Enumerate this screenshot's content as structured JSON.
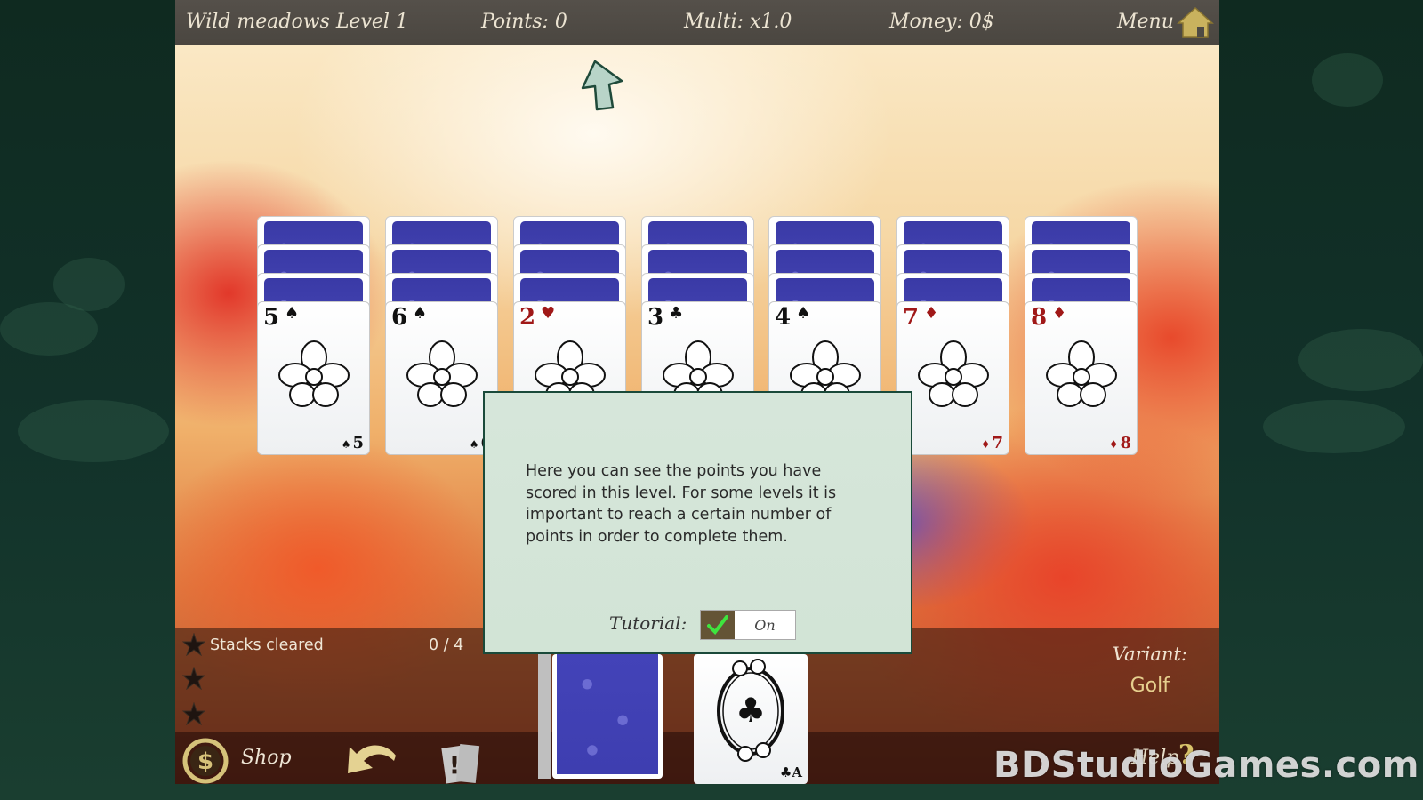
{
  "topbar": {
    "level_title": "Wild meadows Level 1",
    "points": "Points: 0",
    "multiplier": "Multi: x1.0",
    "money": "Money: 0$",
    "menu_label": "Menu",
    "menu_icon": "home-icon"
  },
  "tableau": [
    {
      "rank": "5",
      "suit": "♠",
      "suit_name": "spades",
      "color": "black",
      "flower": "orchid",
      "face_down_count": 3
    },
    {
      "rank": "6",
      "suit": "♠",
      "suit_name": "spades",
      "color": "black",
      "flower": "lily",
      "face_down_count": 3
    },
    {
      "rank": "2",
      "suit": "♥",
      "suit_name": "hearts",
      "color": "red",
      "flower": "daffodil",
      "face_down_count": 3
    },
    {
      "rank": "3",
      "suit": "♣",
      "suit_name": "clubs",
      "color": "black",
      "flower": "iris",
      "face_down_count": 3
    },
    {
      "rank": "4",
      "suit": "♠",
      "suit_name": "spades",
      "color": "black",
      "flower": "poppy",
      "face_down_count": 3
    },
    {
      "rank": "7",
      "suit": "♦",
      "suit_name": "diamonds",
      "color": "red",
      "flower": "magnolia",
      "face_down_count": 3
    },
    {
      "rank": "8",
      "suit": "♦",
      "suit_name": "diamonds",
      "color": "red",
      "flower": "sunflower",
      "face_down_count": 3
    }
  ],
  "dialog": {
    "text": "Here you can see the points you have scored in this level. For some levels it is important to reach a certain number of points in order to complete them.",
    "tutorial_label": "Tutorial:",
    "tutorial_toggle_label": "On",
    "tutorial_enabled": true
  },
  "goals": {
    "label": "Stacks cleared",
    "count": "0 / 4",
    "stars_earned": 0,
    "stars_total": 3
  },
  "variant": {
    "label": "Variant:",
    "value": "Golf"
  },
  "bottombar": {
    "shop_label": "Shop",
    "help_label": "Help",
    "help_icon": "?"
  },
  "foundation": {
    "rank": "A",
    "suit": "♣",
    "corner": "♣A"
  },
  "colors": {
    "topbar_bg": "#4e4a44",
    "dialog_bg": "#d4e5d8",
    "dialog_border": "#1a4a3a",
    "card_back": "#3e3eb0",
    "red_suit": "#a01818",
    "gold_accent": "#d9c36a",
    "page_bg": "#12322a"
  },
  "watermark": "BDStudioGames.com"
}
